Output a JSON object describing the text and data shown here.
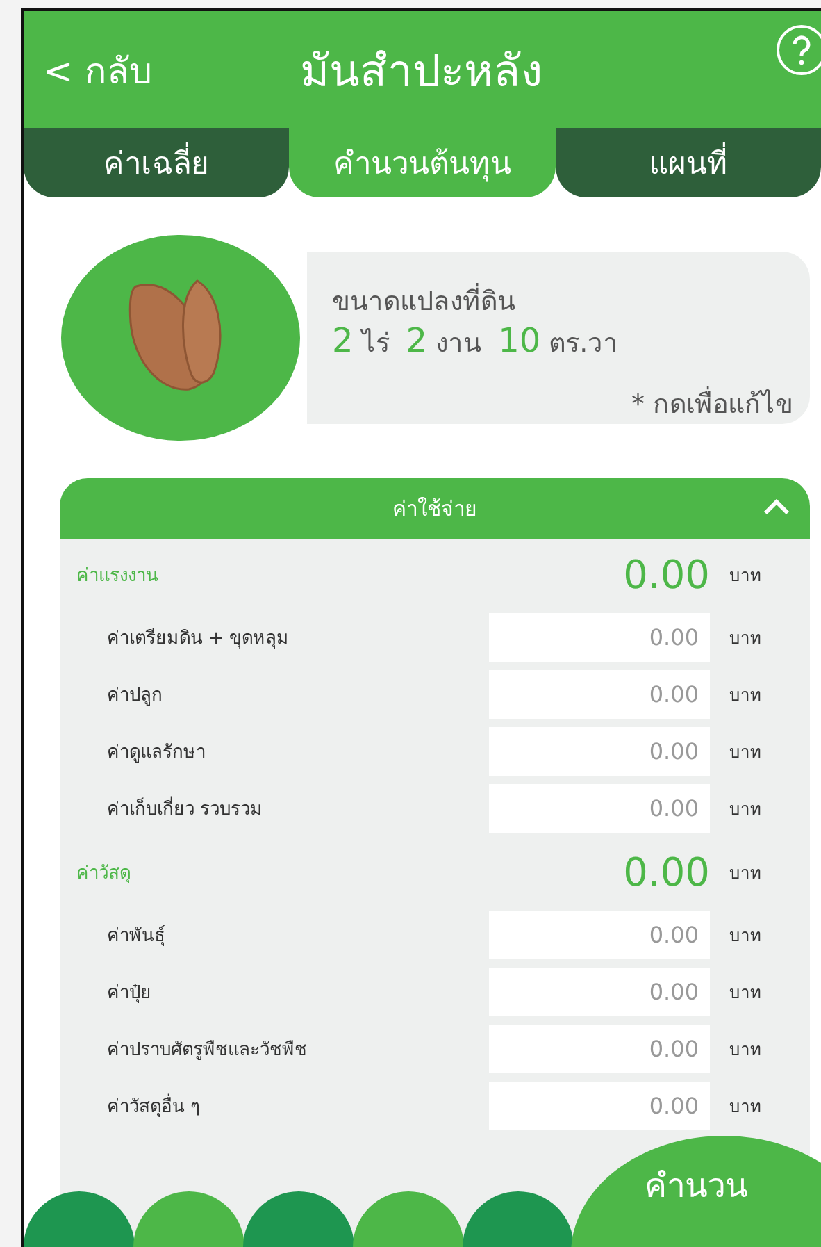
{
  "header": {
    "back": "< กลับ",
    "title": "มันสำปะหลัง"
  },
  "tabs": [
    {
      "label": "ค่าเฉลี่ย",
      "selected": false
    },
    {
      "label": "คำนวนต้นทุน",
      "selected": true
    },
    {
      "label": "แผนที่",
      "selected": false
    }
  ],
  "land": {
    "label": "ขนาดแปลงที่ดิน",
    "parts": [
      {
        "value": "2",
        "unit": "ไร่"
      },
      {
        "value": "2",
        "unit": "งาน"
      },
      {
        "value": "10",
        "unit": "ตร.วา"
      }
    ],
    "hint": "* กดเพื่อแก้ไข"
  },
  "expenses": {
    "title": "ค่าใช้จ่าย",
    "expanded": true,
    "groups": [
      {
        "name": "ค่าแรงงาน",
        "total": "0.00",
        "unit": "บาท",
        "items": [
          {
            "label": "ค่าเตรียมดิน + ขุดหลุม",
            "placeholder": "0.00",
            "unit": "บาท"
          },
          {
            "label": "ค่าปลูก",
            "placeholder": "0.00",
            "unit": "บาท"
          },
          {
            "label": "ค่าดูแลรักษา",
            "placeholder": "0.00",
            "unit": "บาท"
          },
          {
            "label": "ค่าเก็บเกี่ยว รวบรวม",
            "placeholder": "0.00",
            "unit": "บาท"
          }
        ]
      },
      {
        "name": "ค่าวัสดุ",
        "total": "0.00",
        "unit": "บาท",
        "items": [
          {
            "label": "ค่าพันธุ์",
            "placeholder": "0.00",
            "unit": "บาท"
          },
          {
            "label": "ค่าปุ๋ย",
            "placeholder": "0.00",
            "unit": "บาท"
          },
          {
            "label": "ค่าปราบศัตรูพืชและวัชพืช",
            "placeholder": "0.00",
            "unit": "บาท"
          },
          {
            "label": "ค่าวัสดุอื่น ๆ",
            "placeholder": "0.00",
            "unit": "บาท"
          }
        ]
      }
    ]
  },
  "calculate_button": "คำนวน"
}
